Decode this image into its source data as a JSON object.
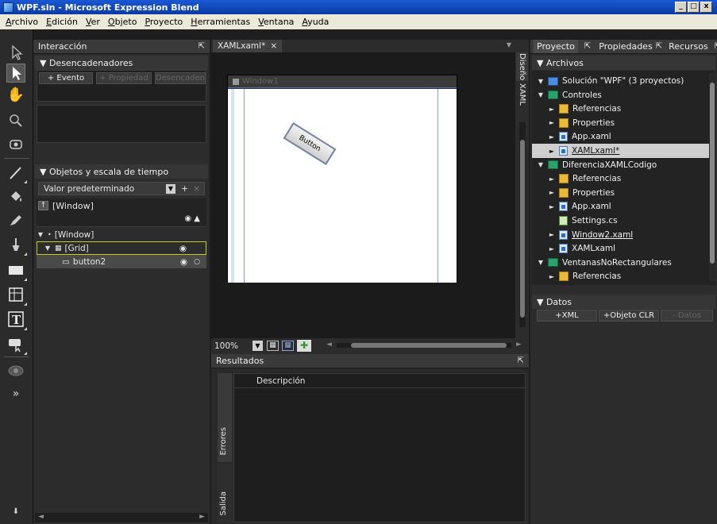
{
  "window": {
    "title": "WPF.sln - Microsoft Expression Blend",
    "min": "_",
    "max": "□",
    "close": "x"
  },
  "menu": [
    "Archivo",
    "Edición",
    "Ver",
    "Objeto",
    "Proyecto",
    "Herramientas",
    "Ventana",
    "Ayuda"
  ],
  "interaction": {
    "title": "Interacción",
    "triggers_header": "▼ Desencadenadores",
    "btn_event": "+ Evento",
    "btn_property": "+ Propiedad",
    "btn_trigger": "Desencadena",
    "objects_header": "▼ Objetos y escala de tiempo",
    "default_value": "Valor predeterminado",
    "scope_window": "[Window]",
    "tree": {
      "window": "[Window]",
      "grid": "[Grid]",
      "button": "button2"
    }
  },
  "document": {
    "tab": "XAMLxaml*",
    "tab_close": "×",
    "window_caption": "Window1",
    "button_label": "Button",
    "view_design": "Diseño",
    "view_xaml": "XAML",
    "zoom": "100%"
  },
  "results": {
    "title": "Resultados",
    "column": "Descripción",
    "tab_errors": "Errores",
    "tab_output": "Salida"
  },
  "right": {
    "tabs": [
      "Proyecto",
      "Propiedades",
      "Recursos"
    ],
    "files_header": "▼ Archivos",
    "items": [
      {
        "label": "Solución \"WPF\" (3 proyectos)",
        "icon": "solution-icon",
        "indent": 0,
        "arrow": "▼"
      },
      {
        "label": "Controles",
        "icon": "project-icon",
        "indent": 0,
        "arrow": "▼"
      },
      {
        "label": "Referencias",
        "icon": "folder-icon",
        "indent": 1,
        "arrow": "►"
      },
      {
        "label": "Properties",
        "icon": "folder-icon",
        "indent": 1,
        "arrow": "►"
      },
      {
        "label": "App.xaml",
        "icon": "xaml-file-icon",
        "indent": 1,
        "arrow": "►"
      },
      {
        "label": "XAMLxaml*",
        "icon": "xaml-file-icon",
        "indent": 1,
        "arrow": "►",
        "selected": true
      },
      {
        "label": "DiferenciaXAMLCodigo",
        "icon": "project-icon",
        "indent": 0,
        "arrow": "▼"
      },
      {
        "label": "Referencias",
        "icon": "folder-icon",
        "indent": 1,
        "arrow": "►"
      },
      {
        "label": "Properties",
        "icon": "folder-icon",
        "indent": 1,
        "arrow": "►"
      },
      {
        "label": "App.xaml",
        "icon": "xaml-file-icon",
        "indent": 1,
        "arrow": "►"
      },
      {
        "label": "Settings.cs",
        "icon": "cs-file-icon",
        "indent": 1,
        "arrow": ""
      },
      {
        "label": "Window2.xaml",
        "icon": "xaml-file-icon",
        "indent": 1,
        "arrow": "►",
        "underline": true
      },
      {
        "label": "XAMLxaml",
        "icon": "xaml-file-icon",
        "indent": 1,
        "arrow": "►"
      },
      {
        "label": "VentanasNoRectangulares",
        "icon": "project-icon",
        "indent": 0,
        "arrow": "▼"
      },
      {
        "label": "Referencias",
        "icon": "folder-icon",
        "indent": 1,
        "arrow": "►"
      }
    ],
    "data_header": "▼ Datos",
    "btn_xml": "+XML",
    "btn_clr": "+Objeto CLR",
    "btn_data": "- Datos"
  }
}
